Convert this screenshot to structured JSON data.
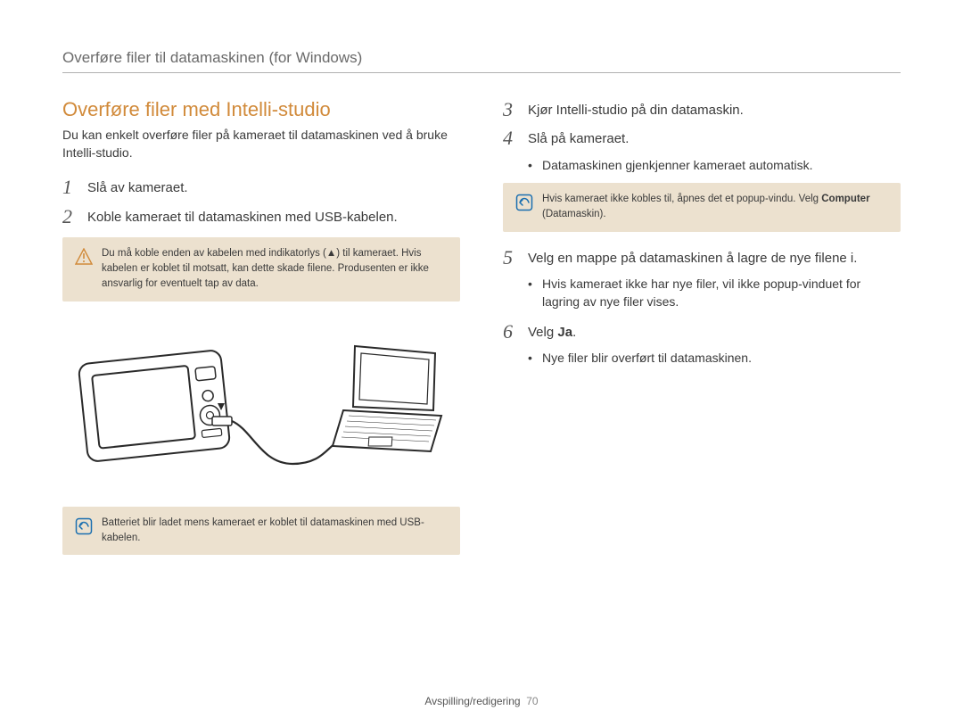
{
  "header": {
    "breadcrumb": "Overføre filer til datamaskinen (for Windows)"
  },
  "left": {
    "title": "Overføre filer med Intelli-studio",
    "intro": "Du kan enkelt overføre filer på kameraet til datamaskinen ved å bruke Intelli-studio.",
    "step1": {
      "num": "1",
      "text": "Slå av kameraet."
    },
    "step2": {
      "num": "2",
      "text": "Koble kameraet til datamaskinen med USB-kabelen."
    },
    "warning": "Du må koble enden av kabelen med indikatorlys (▲) til kameraet. Hvis kabelen er koblet til motsatt, kan dette skade filene. Produsenten er ikke ansvarlig for eventuelt tap av data.",
    "info": "Batteriet blir ladet mens kameraet er koblet til datamaskinen med USB-kabelen."
  },
  "right": {
    "step3": {
      "num": "3",
      "text": "Kjør Intelli-studio på din datamaskin."
    },
    "step4": {
      "num": "4",
      "text": "Slå på kameraet.",
      "bullet": "Datamaskinen gjenkjenner kameraet automatisk."
    },
    "info_prefix": "Hvis kameraet ikke kobles til, åpnes det et popup-vindu. Velg ",
    "info_bold": "Computer",
    "info_suffix": " (Datamaskin).",
    "step5": {
      "num": "5",
      "text": "Velg en mappe på datamaskinen å lagre de nye filene i.",
      "bullet": "Hvis kameraet ikke har nye filer, vil ikke popup-vinduet for lagring av nye filer vises."
    },
    "step6": {
      "num": "6",
      "prefix": "Velg ",
      "bold": "Ja",
      "suffix": ".",
      "bullet": "Nye filer blir overført til datamaskinen."
    }
  },
  "footer": {
    "section": "Avspilling/redigering",
    "page": "70"
  }
}
